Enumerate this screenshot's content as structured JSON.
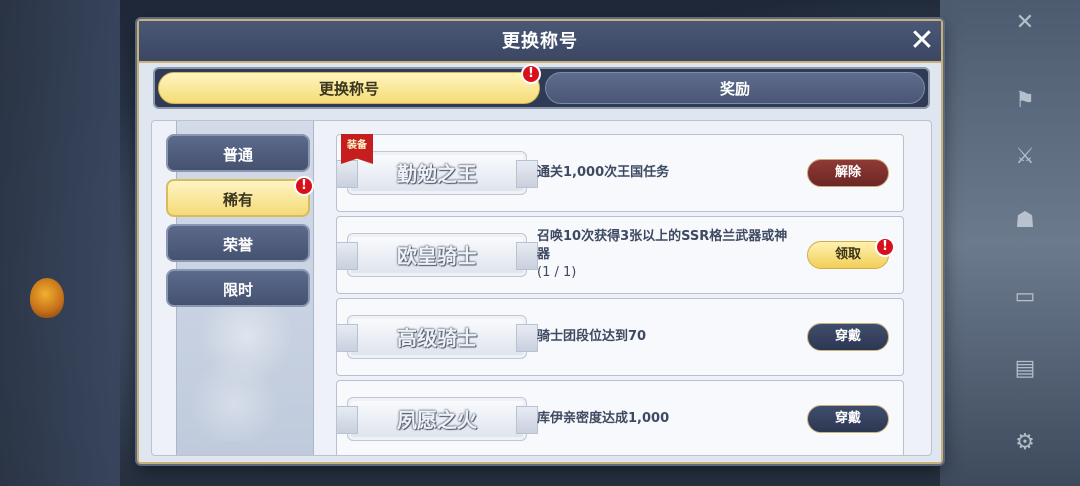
{
  "dialog": {
    "title": "更换称号",
    "close_icon": "close-icon"
  },
  "tabs": [
    {
      "label": "更换称号",
      "active": true,
      "alert": true
    },
    {
      "label": "奖励",
      "active": false,
      "alert": false
    }
  ],
  "categories": [
    {
      "label": "普通",
      "selected": false,
      "alert": false
    },
    {
      "label": "稀有",
      "selected": true,
      "alert": true
    },
    {
      "label": "荣誉",
      "selected": false,
      "alert": false
    },
    {
      "label": "限时",
      "selected": false,
      "alert": false
    }
  ],
  "alert_glyph": "!",
  "titles": [
    {
      "name": "勤勉之王",
      "ribbon": "装备",
      "description": "通关1,000次王国任务",
      "progress": "",
      "action": "解除",
      "action_style": "danger",
      "alert": false
    },
    {
      "name": "欧皇骑士",
      "ribbon": "",
      "description": "召唤10次获得3张以上的SSR格兰武器或神器",
      "progress": "(1 / 1)",
      "action": "领取",
      "action_style": "gold",
      "alert": true
    },
    {
      "name": "高级骑士",
      "ribbon": "",
      "description": "骑士团段位达到70",
      "progress": "",
      "action": "穿戴",
      "action_style": "navy",
      "alert": false
    },
    {
      "name": "夙愿之火",
      "ribbon": "",
      "description": "库伊亲密度达成1,000",
      "progress": "",
      "action": "穿戴",
      "action_style": "navy",
      "alert": false
    }
  ],
  "colors": {
    "header_navy": "#3b4763",
    "active_gold": "#f5dc76",
    "alert_red": "#d8101c",
    "ribbon_red": "#c61e1e"
  }
}
